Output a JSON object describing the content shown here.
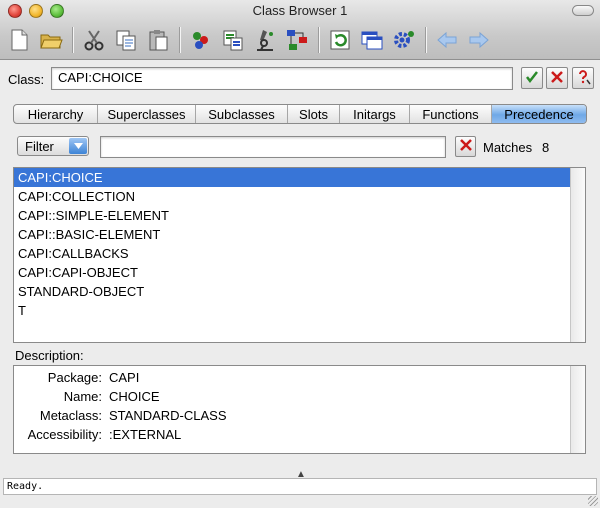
{
  "window": {
    "title": "Class Browser 1"
  },
  "toolbar": {
    "icons": [
      "new-file-icon",
      "open-folder-icon",
      "cut-icon",
      "copy-icon",
      "paste-icon",
      "inspect-icon",
      "documents-icon",
      "microscope-icon",
      "graph-icon",
      "refresh-icon",
      "windows-icon",
      "settings-gear-icon",
      "back-arrow-icon",
      "forward-arrow-icon"
    ]
  },
  "class_row": {
    "label": "Class:",
    "value": "CAPI:CHOICE"
  },
  "tabs": [
    {
      "label": "Hierarchy",
      "active": false
    },
    {
      "label": "Superclasses",
      "active": false
    },
    {
      "label": "Subclasses",
      "active": false
    },
    {
      "label": "Slots",
      "active": false
    },
    {
      "label": "Initargs",
      "active": false
    },
    {
      "label": "Functions",
      "active": false
    },
    {
      "label": "Precedence",
      "active": true
    }
  ],
  "filter": {
    "button_label": "Filter",
    "value": "",
    "matches_label": "Matches",
    "matches_count": "8"
  },
  "precedence_list": [
    "CAPI:CHOICE",
    "CAPI:COLLECTION",
    "CAPI::SIMPLE-ELEMENT",
    "CAPI::BASIC-ELEMENT",
    "CAPI:CALLBACKS",
    "CAPI:CAPI-OBJECT",
    "STANDARD-OBJECT",
    "T"
  ],
  "selected_index": 0,
  "description": {
    "label": "Description:",
    "rows": [
      {
        "key": "Package:",
        "value": "CAPI"
      },
      {
        "key": "Name:",
        "value": "CHOICE"
      },
      {
        "key": "Metaclass:",
        "value": "STANDARD-CLASS"
      },
      {
        "key": "Accessibility:",
        "value": ":EXTERNAL"
      }
    ]
  },
  "status": {
    "text": "Ready."
  },
  "colors": {
    "selection": "#3875d7",
    "tab_active": "#6fa8e6",
    "ok_green": "#2a8a2a",
    "cancel_red": "#cc1a1a"
  }
}
